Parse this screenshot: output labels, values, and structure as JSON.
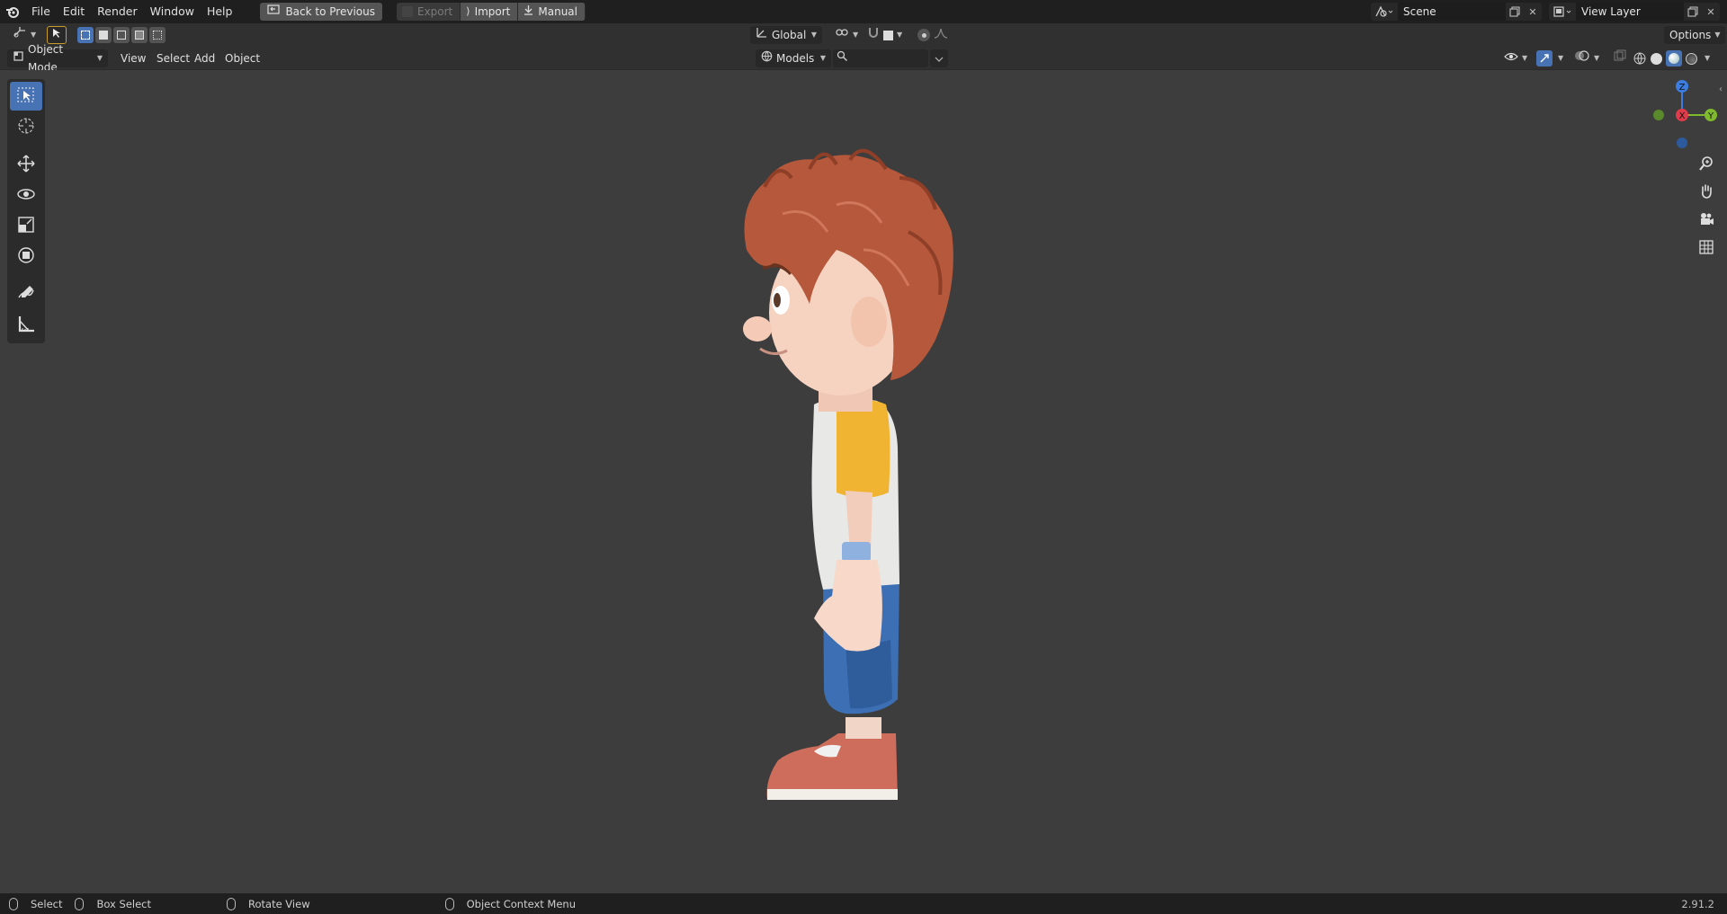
{
  "menu": {
    "file": "File",
    "edit": "Edit",
    "render": "Render",
    "window": "Window",
    "help": "Help"
  },
  "back_button": "Back to Previous",
  "workspace_tabs": {
    "export": "Export",
    "import": "Import",
    "manual": "Manual"
  },
  "scene": {
    "name": "Scene"
  },
  "view_layer": {
    "name": "View Layer"
  },
  "tool_header": {
    "transform_orientation": "Global",
    "options": "Options"
  },
  "viewport_header": {
    "mode": "Object Mode",
    "view": "View",
    "select": "Select",
    "add": "Add",
    "object": "Object",
    "collection": "Models",
    "search_placeholder": ""
  },
  "gizmo": {
    "z": "Z",
    "x": "X",
    "y": "Y"
  },
  "statusbar": {
    "select": "Select",
    "box_select": "Box Select",
    "rotate_view": "Rotate View",
    "context_menu": "Object Context Menu",
    "version": "2.91.2"
  },
  "colors": {
    "accent": "#4772b3",
    "bg": "#3d3d3d",
    "header": "#303030",
    "topbar": "#1f1f1f"
  }
}
